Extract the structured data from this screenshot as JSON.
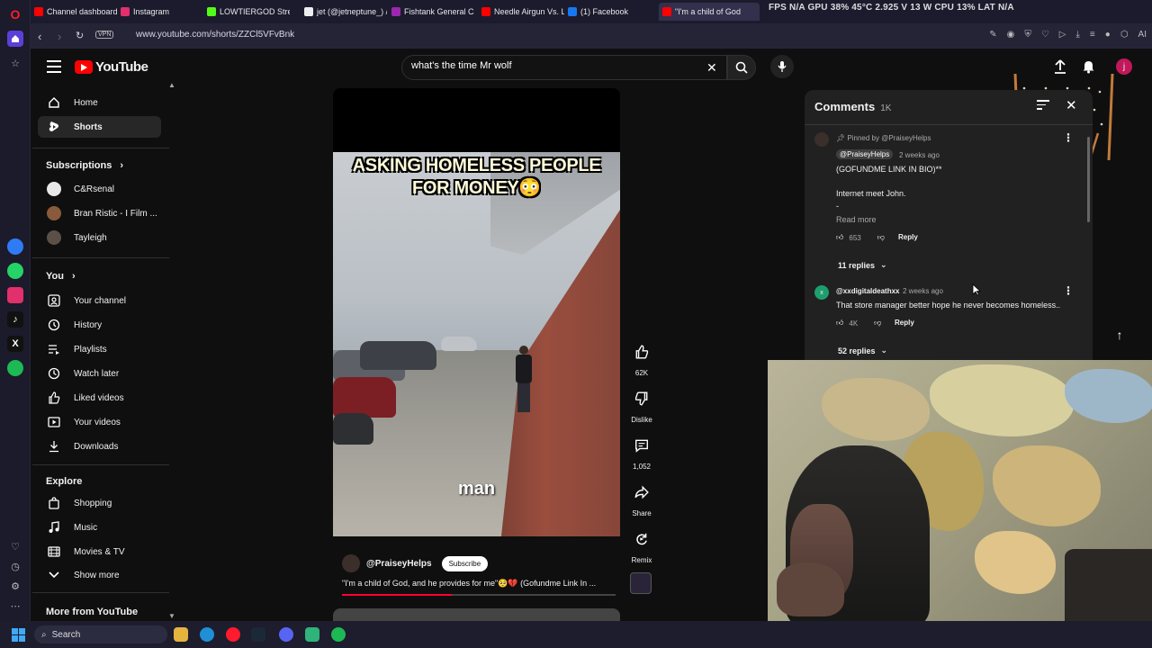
{
  "browser": {
    "tabs": [
      {
        "label": "Channel dashboard",
        "color": "#ff0000"
      },
      {
        "label": "Instagram",
        "color": "#e1306c"
      },
      {
        "label": "LOWTIERGOD Stream",
        "color": "#53fc18"
      },
      {
        "label": "jet (@jetneptune_) / X",
        "color": "#ffffff"
      },
      {
        "label": "Fishtank General Can",
        "color": "#9c27b0"
      },
      {
        "label": "Needle Airgun Vs. Le",
        "color": "#ff0000"
      },
      {
        "label": "(1) Facebook",
        "color": "#1877f2"
      },
      {
        "label": "\"I'm a child of God",
        "color": "#ff0000"
      }
    ],
    "hud_text": "FPS N/A  GPU 38%  45°C  2.925 V 13 W  CPU 13%  LAT N/A",
    "url": "www.youtube.com/shorts/ZZCl5VFvBnk",
    "vpn": "VPN",
    "ai_label": "AI"
  },
  "youtube": {
    "logo_text": "YouTube",
    "search_query": "what's the time Mr wolf",
    "avatar_letter": "j"
  },
  "sidebar": {
    "main": [
      {
        "label": "Home",
        "icon": "home-icon"
      },
      {
        "label": "Shorts",
        "icon": "shorts-icon"
      }
    ],
    "subscriptions_title": "Subscriptions",
    "subscriptions": [
      {
        "label": "C&Rsenal",
        "color": "#e8e8e8"
      },
      {
        "label": "Bran Ristic - I Film ...",
        "color": "#8a5a3c"
      },
      {
        "label": "Tayleigh",
        "color": "#5b5048"
      }
    ],
    "you_title": "You",
    "you": [
      {
        "label": "Your channel",
        "icon": "person-icon"
      },
      {
        "label": "History",
        "icon": "history-icon"
      },
      {
        "label": "Playlists",
        "icon": "playlist-icon"
      },
      {
        "label": "Watch later",
        "icon": "clock-icon"
      },
      {
        "label": "Liked videos",
        "icon": "thumbs-up-icon"
      },
      {
        "label": "Your videos",
        "icon": "video-icon"
      },
      {
        "label": "Downloads",
        "icon": "download-icon"
      }
    ],
    "explore_title": "Explore",
    "explore": [
      {
        "label": "Shopping",
        "icon": "shopping-icon"
      },
      {
        "label": "Music",
        "icon": "music-icon"
      },
      {
        "label": "Movies & TV",
        "icon": "film-icon"
      },
      {
        "label": "Show more",
        "icon": "chevron-down-icon"
      }
    ],
    "more_title": "More from YouTube"
  },
  "video": {
    "caption_top": "ASKING HOMELESS PEOPLE FOR MONEY😳",
    "caption_sub": "man",
    "channel": "@PraiseyHelps",
    "subscribe": "Subscribe",
    "description": "\"I'm a child of God, and he provides for me\"🥺💔 (Gofundme Link In ...",
    "progress": 0.4
  },
  "rail": {
    "likes": "62K",
    "dislike": "Dislike",
    "comments": "1,052",
    "share": "Share",
    "remix": "Remix"
  },
  "comments": {
    "title": "Comments",
    "count": "1K",
    "items": [
      {
        "pinned": "Pinned by @PraiseyHelps",
        "author": "@PraiseyHelps",
        "time": "2 weeks ago",
        "line1": "(GOFUNDME LINK IN BIO)**",
        "line2": "Internet meet John.",
        "line3": "-",
        "more": "Read more",
        "likes": "653",
        "reply": "Reply",
        "replies": "11 replies"
      },
      {
        "author": "@xxdigitaldeathxx",
        "time": "2 weeks ago",
        "line1": "That store manager better hope he never becomes homeless..",
        "likes": "4K",
        "reply": "Reply",
        "replies": "52 replies"
      }
    ]
  },
  "taskbar": {
    "search": "Search"
  }
}
